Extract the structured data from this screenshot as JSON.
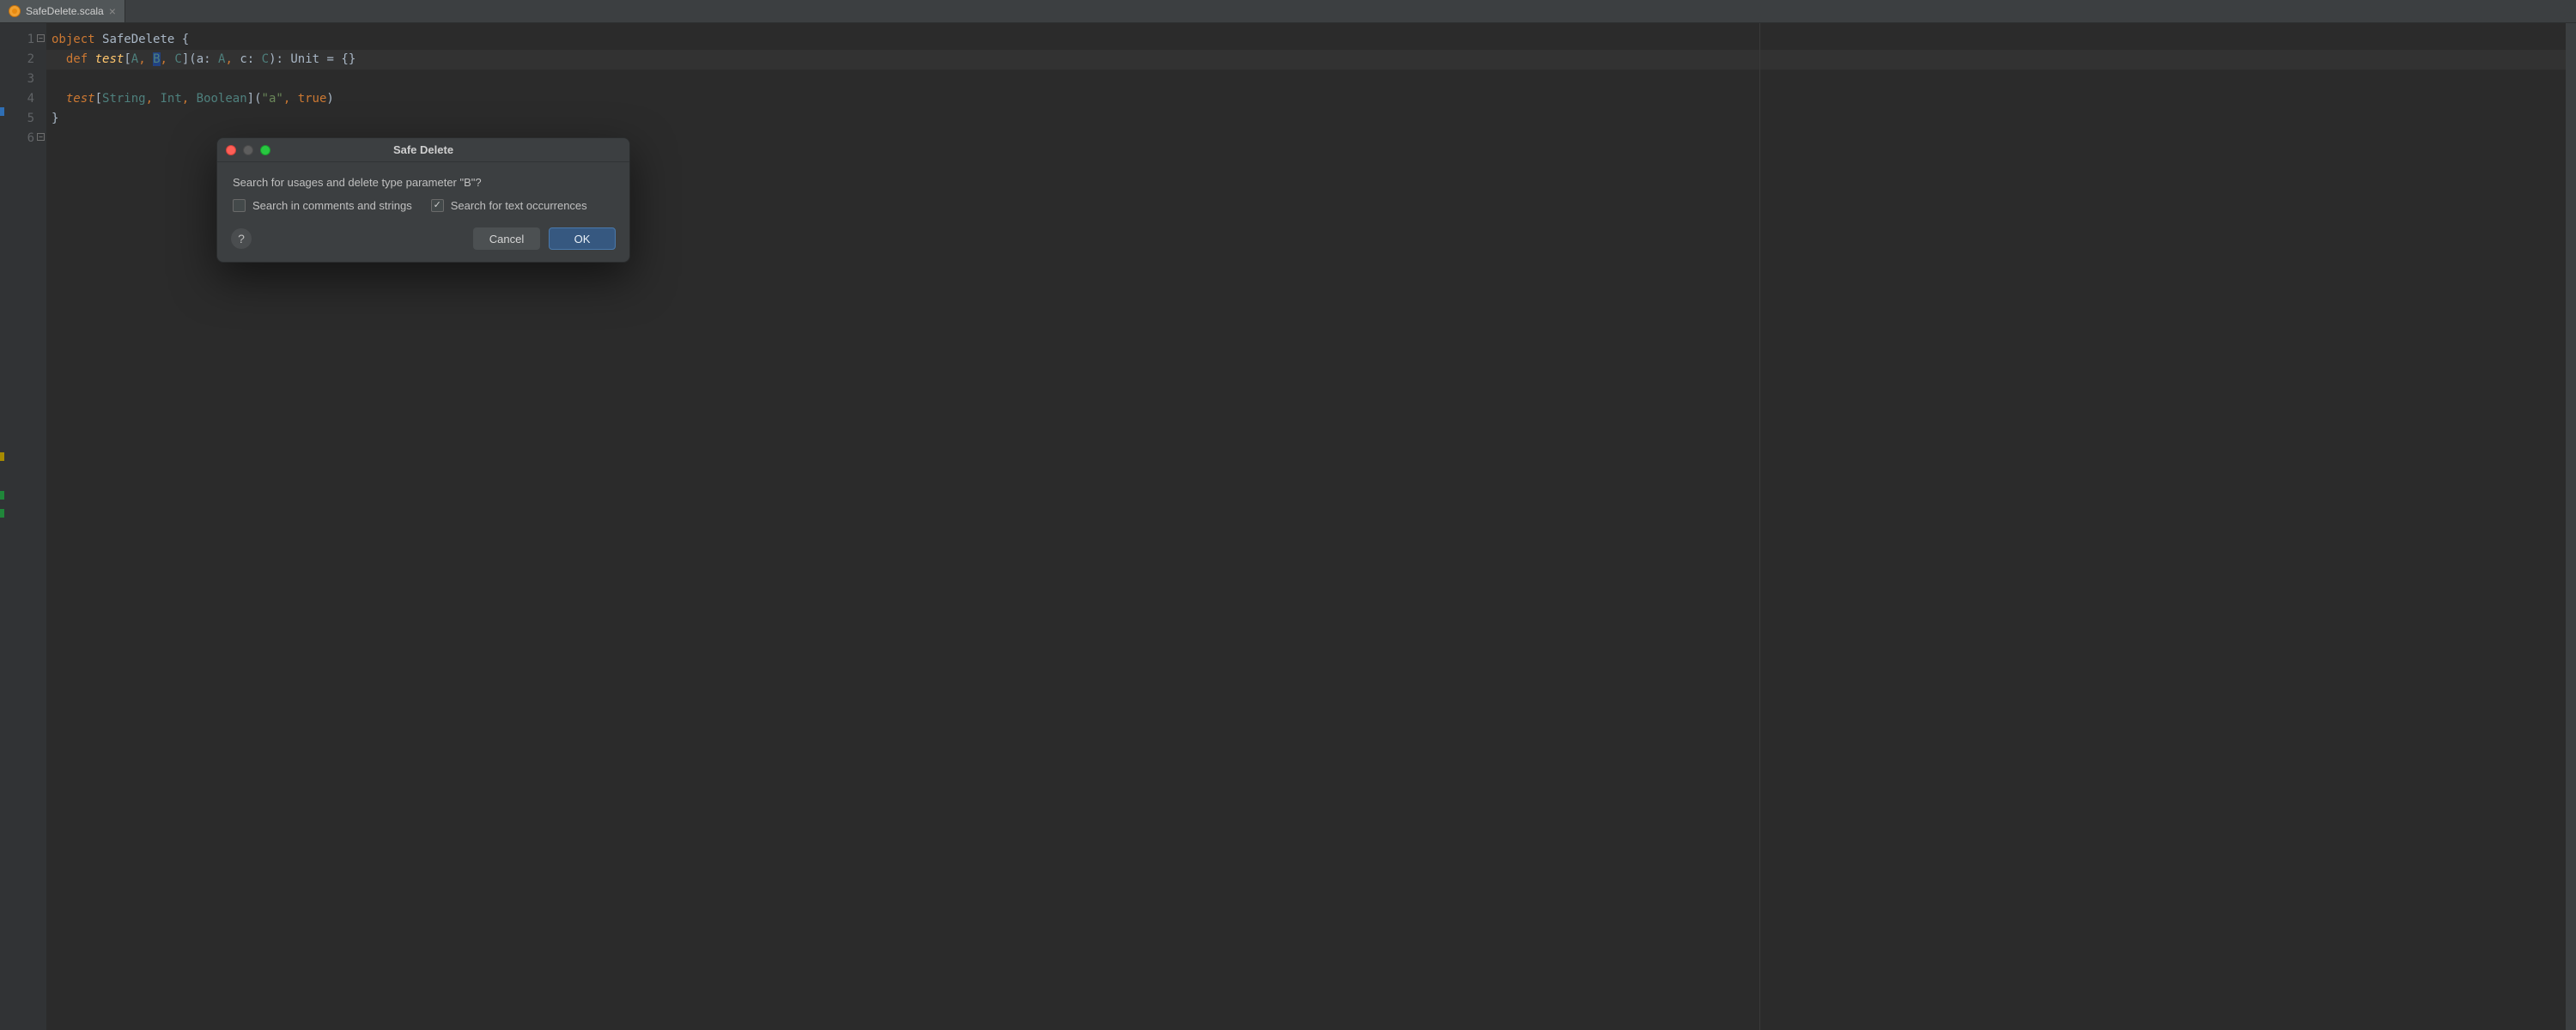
{
  "tab": {
    "filename": "SafeDelete.scala",
    "close_glyph": "×"
  },
  "gutter": {
    "lines": [
      "1",
      "2",
      "3",
      "4",
      "5",
      "6"
    ]
  },
  "code": {
    "line1": {
      "w1": "object",
      "space1": " ",
      "name": "SafeDelete",
      "space2": " ",
      "brace": "{"
    },
    "line2": {
      "indent": "  ",
      "kw": "def",
      "space1": " ",
      "fn": "test",
      "open_bracket": "[",
      "A": "A",
      "comma1": ",",
      "space2": " ",
      "B": "B",
      "comma2": ",",
      "space3": " ",
      "C": "C",
      "close_bracket": "]",
      "open_paren": "(",
      "a": "a",
      "colon1": ":",
      "space4": " ",
      "At": "A",
      "comma3": ",",
      "space5": " ",
      "c": "c",
      "colon2": ":",
      "space6": " ",
      "Ct": "C",
      "close_paren": ")",
      "colon3": ":",
      "space7": " ",
      "Unit": "Unit",
      "space8": " ",
      "eq": "=",
      "space9": " ",
      "braces": "{}"
    },
    "line4": {
      "indent": "  ",
      "call": "test",
      "open_bracket": "[",
      "String": "String",
      "comma1": ",",
      "space1": " ",
      "Int": "Int",
      "comma2": ",",
      "space2": " ",
      "Boolean": "Boolean",
      "close_bracket": "]",
      "open_paren": "(",
      "str": "\"a\"",
      "comma3": ",",
      "space3": " ",
      "true": "true",
      "close_paren": ")"
    },
    "line5": {
      "brace": "}"
    }
  },
  "dialog": {
    "title": "Safe Delete",
    "message": "Search for usages and delete type parameter \"B\"?",
    "opt_comments": "Search in comments and strings",
    "opt_text": "Search for text occurrences",
    "opt_comments_checked": false,
    "opt_text_checked": true,
    "help_glyph": "?",
    "cancel": "Cancel",
    "ok": "OK"
  }
}
